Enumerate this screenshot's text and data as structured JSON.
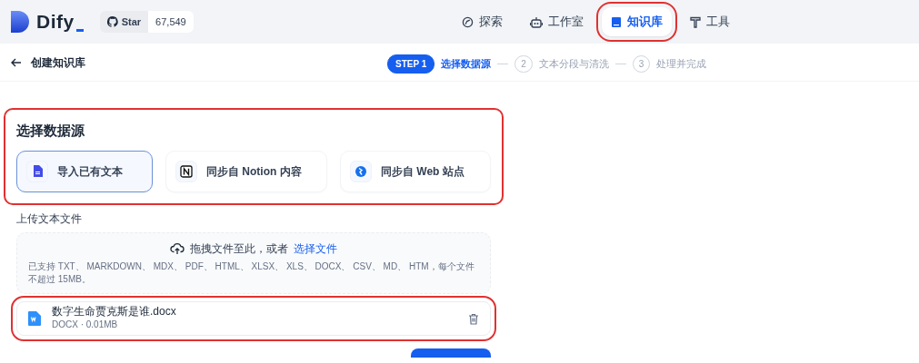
{
  "header": {
    "logo": "Dify",
    "github": {
      "label": "Star",
      "count": "67,549"
    },
    "nav": [
      {
        "label": "探索",
        "selected": false,
        "highlighted": false
      },
      {
        "label": "工作室",
        "selected": false,
        "highlighted": false
      },
      {
        "label": "知识库",
        "selected": true,
        "highlighted": true
      },
      {
        "label": "工具",
        "selected": false,
        "highlighted": false
      }
    ]
  },
  "subheader": {
    "title": "创建知识库",
    "steps": [
      {
        "badge": "STEP 1",
        "label": "选择数据源",
        "selected": true
      },
      {
        "badge": "2",
        "label": "文本分段与清洗",
        "selected": false
      },
      {
        "badge": "3",
        "label": "处理并完成",
        "selected": false
      }
    ]
  },
  "data_source": {
    "title": "选择数据源",
    "highlighted": true,
    "options": [
      {
        "label": "导入已有文本",
        "selected": true
      },
      {
        "label": "同步自 Notion 内容",
        "selected": false
      },
      {
        "label": "同步自 Web 站点",
        "selected": false
      }
    ]
  },
  "upload": {
    "label": "上传文本文件",
    "drop_text": "拖拽文件至此，或者",
    "drop_link": "选择文件",
    "hint": "已支持 TXT、 MARKDOWN、 MDX、 PDF、 HTML、 XLSX、 XLS、 DOCX、 CSV、 MD、 HTM，每个文件不超过 15MB。",
    "files": [
      {
        "name": "数字生命贾克斯是谁.docx",
        "meta": "DOCX · 0.01MB",
        "highlighted": true
      }
    ]
  },
  "next_button": {
    "kind": "primary"
  }
}
